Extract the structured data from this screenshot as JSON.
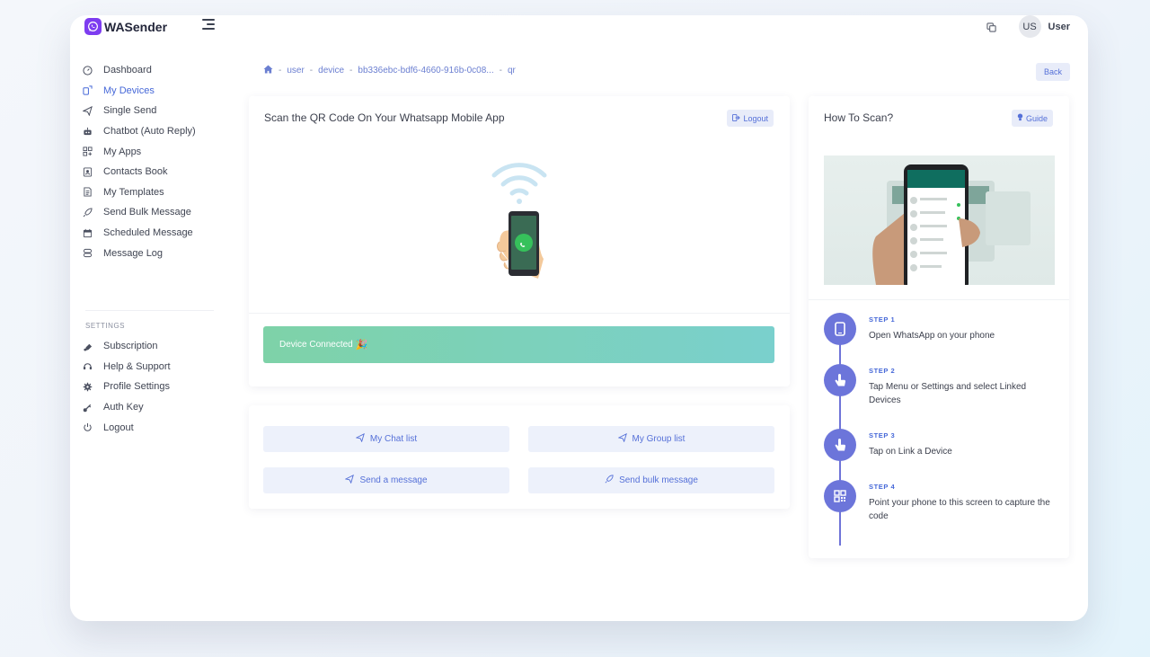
{
  "app": {
    "brand": "WASender"
  },
  "header": {
    "avatar_initials": "US",
    "user_name": "User"
  },
  "sidebar": {
    "items": [
      {
        "label": "Dashboard",
        "icon": "dashboard-icon"
      },
      {
        "label": "My Devices",
        "icon": "devices-icon",
        "active": true
      },
      {
        "label": "Single Send",
        "icon": "send-icon"
      },
      {
        "label": "Chatbot (Auto Reply)",
        "icon": "robot-icon"
      },
      {
        "label": "My Apps",
        "icon": "apps-icon"
      },
      {
        "label": "Contacts Book",
        "icon": "contacts-icon"
      },
      {
        "label": "My Templates",
        "icon": "templates-icon"
      },
      {
        "label": "Send Bulk Message",
        "icon": "rocket-icon"
      },
      {
        "label": "Scheduled Message",
        "icon": "calendar-icon"
      },
      {
        "label": "Message Log",
        "icon": "log-icon"
      }
    ],
    "settings_heading": "SETTINGS",
    "settings_items": [
      {
        "label": "Subscription",
        "icon": "subscription-icon"
      },
      {
        "label": "Help & Support",
        "icon": "support-icon"
      },
      {
        "label": "Profile Settings",
        "icon": "gear-icon"
      },
      {
        "label": "Auth Key",
        "icon": "key-icon"
      },
      {
        "label": "Logout",
        "icon": "power-icon"
      }
    ]
  },
  "breadcrumb": {
    "items": [
      "user",
      "device",
      "bb336ebc-bdf6-4660-916b-0c08...",
      "qr"
    ],
    "separator": "-"
  },
  "back_label": "Back",
  "qr_card": {
    "title": "Scan the QR Code On Your Whatsapp Mobile App",
    "logout_label": "Logout",
    "status_text": "Device Connected",
    "status_emoji": "🎉"
  },
  "actions": {
    "chat_list": "My Chat list",
    "group_list": "My Group list",
    "send_message": "Send a message",
    "send_bulk": "Send bulk message"
  },
  "how_card": {
    "title": "How To Scan?",
    "guide_label": "Guide",
    "steps": [
      {
        "label": "STEP 1",
        "text": "Open WhatsApp on your phone",
        "icon": "phone-icon"
      },
      {
        "label": "STEP 2",
        "text": "Tap Menu or Settings and select Linked Devices",
        "icon": "tap-icon"
      },
      {
        "label": "STEP 3",
        "text": "Tap on Link a Device",
        "icon": "tap-icon"
      },
      {
        "label": "STEP 4",
        "text": "Point your phone to this screen to capture the code",
        "icon": "qr-icon"
      }
    ]
  },
  "colors": {
    "accent": "#4668d8",
    "status_gradient_start": "#7ed2a8",
    "status_gradient_end": "#7ad0cd",
    "timeline": "#6c75da",
    "brand": "#7d3cf0"
  }
}
